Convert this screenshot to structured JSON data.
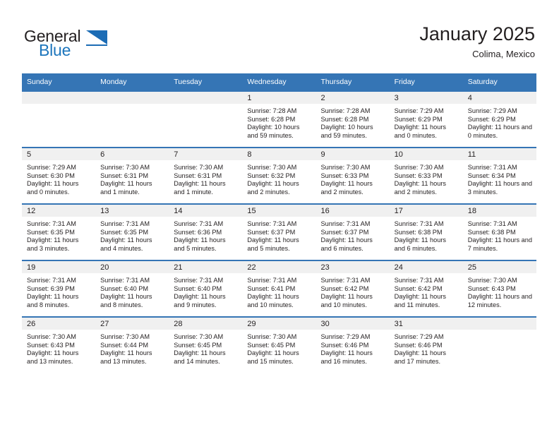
{
  "brand": {
    "word_one": "General",
    "word_two": "Blue",
    "icon": "triangle-logo-icon",
    "accent_color": "#1c6cb5"
  },
  "header": {
    "title": "January 2025",
    "subtitle": "Colima, Mexico"
  },
  "theme": {
    "header_row_color": "#3575b5",
    "day_band_color": "#f0f0f0",
    "text_color": "#231f20"
  },
  "weekday_headers": [
    "Sunday",
    "Monday",
    "Tuesday",
    "Wednesday",
    "Thursday",
    "Friday",
    "Saturday"
  ],
  "labels": {
    "sunrise": "Sunrise:",
    "sunset": "Sunset:",
    "daylight": "Daylight:"
  },
  "weeks": [
    [
      {
        "day": "",
        "blank": true
      },
      {
        "day": "",
        "blank": true
      },
      {
        "day": "",
        "blank": true
      },
      {
        "day": "1",
        "sunrise": "Sunrise: 7:28 AM",
        "sunset": "Sunset: 6:28 PM",
        "daylight": "Daylight: 10 hours and 59 minutes."
      },
      {
        "day": "2",
        "sunrise": "Sunrise: 7:28 AM",
        "sunset": "Sunset: 6:28 PM",
        "daylight": "Daylight: 10 hours and 59 minutes."
      },
      {
        "day": "3",
        "sunrise": "Sunrise: 7:29 AM",
        "sunset": "Sunset: 6:29 PM",
        "daylight": "Daylight: 11 hours and 0 minutes."
      },
      {
        "day": "4",
        "sunrise": "Sunrise: 7:29 AM",
        "sunset": "Sunset: 6:29 PM",
        "daylight": "Daylight: 11 hours and 0 minutes."
      }
    ],
    [
      {
        "day": "5",
        "sunrise": "Sunrise: 7:29 AM",
        "sunset": "Sunset: 6:30 PM",
        "daylight": "Daylight: 11 hours and 0 minutes."
      },
      {
        "day": "6",
        "sunrise": "Sunrise: 7:30 AM",
        "sunset": "Sunset: 6:31 PM",
        "daylight": "Daylight: 11 hours and 1 minute."
      },
      {
        "day": "7",
        "sunrise": "Sunrise: 7:30 AM",
        "sunset": "Sunset: 6:31 PM",
        "daylight": "Daylight: 11 hours and 1 minute."
      },
      {
        "day": "8",
        "sunrise": "Sunrise: 7:30 AM",
        "sunset": "Sunset: 6:32 PM",
        "daylight": "Daylight: 11 hours and 2 minutes."
      },
      {
        "day": "9",
        "sunrise": "Sunrise: 7:30 AM",
        "sunset": "Sunset: 6:33 PM",
        "daylight": "Daylight: 11 hours and 2 minutes."
      },
      {
        "day": "10",
        "sunrise": "Sunrise: 7:30 AM",
        "sunset": "Sunset: 6:33 PM",
        "daylight": "Daylight: 11 hours and 2 minutes."
      },
      {
        "day": "11",
        "sunrise": "Sunrise: 7:31 AM",
        "sunset": "Sunset: 6:34 PM",
        "daylight": "Daylight: 11 hours and 3 minutes."
      }
    ],
    [
      {
        "day": "12",
        "sunrise": "Sunrise: 7:31 AM",
        "sunset": "Sunset: 6:35 PM",
        "daylight": "Daylight: 11 hours and 3 minutes."
      },
      {
        "day": "13",
        "sunrise": "Sunrise: 7:31 AM",
        "sunset": "Sunset: 6:35 PM",
        "daylight": "Daylight: 11 hours and 4 minutes."
      },
      {
        "day": "14",
        "sunrise": "Sunrise: 7:31 AM",
        "sunset": "Sunset: 6:36 PM",
        "daylight": "Daylight: 11 hours and 5 minutes."
      },
      {
        "day": "15",
        "sunrise": "Sunrise: 7:31 AM",
        "sunset": "Sunset: 6:37 PM",
        "daylight": "Daylight: 11 hours and 5 minutes."
      },
      {
        "day": "16",
        "sunrise": "Sunrise: 7:31 AM",
        "sunset": "Sunset: 6:37 PM",
        "daylight": "Daylight: 11 hours and 6 minutes."
      },
      {
        "day": "17",
        "sunrise": "Sunrise: 7:31 AM",
        "sunset": "Sunset: 6:38 PM",
        "daylight": "Daylight: 11 hours and 6 minutes."
      },
      {
        "day": "18",
        "sunrise": "Sunrise: 7:31 AM",
        "sunset": "Sunset: 6:38 PM",
        "daylight": "Daylight: 11 hours and 7 minutes."
      }
    ],
    [
      {
        "day": "19",
        "sunrise": "Sunrise: 7:31 AM",
        "sunset": "Sunset: 6:39 PM",
        "daylight": "Daylight: 11 hours and 8 minutes."
      },
      {
        "day": "20",
        "sunrise": "Sunrise: 7:31 AM",
        "sunset": "Sunset: 6:40 PM",
        "daylight": "Daylight: 11 hours and 8 minutes."
      },
      {
        "day": "21",
        "sunrise": "Sunrise: 7:31 AM",
        "sunset": "Sunset: 6:40 PM",
        "daylight": "Daylight: 11 hours and 9 minutes."
      },
      {
        "day": "22",
        "sunrise": "Sunrise: 7:31 AM",
        "sunset": "Sunset: 6:41 PM",
        "daylight": "Daylight: 11 hours and 10 minutes."
      },
      {
        "day": "23",
        "sunrise": "Sunrise: 7:31 AM",
        "sunset": "Sunset: 6:42 PM",
        "daylight": "Daylight: 11 hours and 10 minutes."
      },
      {
        "day": "24",
        "sunrise": "Sunrise: 7:31 AM",
        "sunset": "Sunset: 6:42 PM",
        "daylight": "Daylight: 11 hours and 11 minutes."
      },
      {
        "day": "25",
        "sunrise": "Sunrise: 7:30 AM",
        "sunset": "Sunset: 6:43 PM",
        "daylight": "Daylight: 11 hours and 12 minutes."
      }
    ],
    [
      {
        "day": "26",
        "sunrise": "Sunrise: 7:30 AM",
        "sunset": "Sunset: 6:43 PM",
        "daylight": "Daylight: 11 hours and 13 minutes."
      },
      {
        "day": "27",
        "sunrise": "Sunrise: 7:30 AM",
        "sunset": "Sunset: 6:44 PM",
        "daylight": "Daylight: 11 hours and 13 minutes."
      },
      {
        "day": "28",
        "sunrise": "Sunrise: 7:30 AM",
        "sunset": "Sunset: 6:45 PM",
        "daylight": "Daylight: 11 hours and 14 minutes."
      },
      {
        "day": "29",
        "sunrise": "Sunrise: 7:30 AM",
        "sunset": "Sunset: 6:45 PM",
        "daylight": "Daylight: 11 hours and 15 minutes."
      },
      {
        "day": "30",
        "sunrise": "Sunrise: 7:29 AM",
        "sunset": "Sunset: 6:46 PM",
        "daylight": "Daylight: 11 hours and 16 minutes."
      },
      {
        "day": "31",
        "sunrise": "Sunrise: 7:29 AM",
        "sunset": "Sunset: 6:46 PM",
        "daylight": "Daylight: 11 hours and 17 minutes."
      },
      {
        "day": "",
        "blank": true
      }
    ]
  ]
}
